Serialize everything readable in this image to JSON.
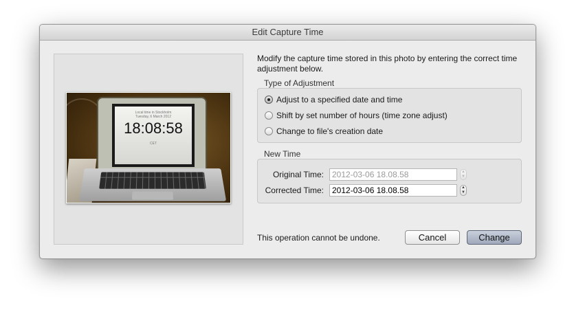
{
  "window": {
    "title": "Edit Capture Time"
  },
  "photo": {
    "screen_line1": "Local time in Stockholm",
    "screen_line2": "Tuesday, 6 March 2012",
    "clock": "18:08:58",
    "screen_line3": "CET"
  },
  "description": "Modify the capture time stored in this photo by entering the correct time adjustment below.",
  "adjustment": {
    "label": "Type of Adjustment",
    "options": [
      {
        "label": "Adjust to a specified date and time",
        "selected": true
      },
      {
        "label": "Shift by set number of hours (time zone adjust)",
        "selected": false
      },
      {
        "label": "Change to file's creation date",
        "selected": false
      }
    ]
  },
  "new_time": {
    "label": "New Time",
    "original_label": "Original Time:",
    "original_value": "2012-03-06 18.08.58",
    "corrected_label": "Corrected Time:",
    "corrected_value": "2012-03-06 18.08.58"
  },
  "warning": "This operation cannot be undone.",
  "buttons": {
    "cancel": "Cancel",
    "change": "Change"
  },
  "icons": {
    "stepper_up": "▲",
    "stepper_down": "▼"
  }
}
